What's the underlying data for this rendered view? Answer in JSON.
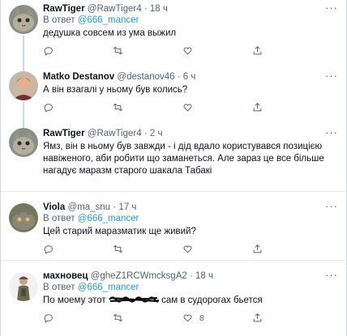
{
  "tweets": [
    {
      "name": "RawTiger",
      "handle": "@RawTiger4",
      "time": "18 ч",
      "reply_prefix": "В ответ",
      "reply_to": "@666_mancer",
      "text": "дедушка совсем из ума выжил",
      "likes": ""
    },
    {
      "name": "Matko Destanov",
      "handle": "@destanov46",
      "time": "6 ч",
      "text": "А він взагалі у ньому був колись?",
      "likes": ""
    },
    {
      "name": "RawTiger",
      "handle": "@RawTiger4",
      "time": "2 ч",
      "text": "Ямз, він в ньому був завжди - і дід вдало користувався позицією навіженого, аби робити що заманеться. Але зараз це все більше нагадує маразм старого шакала Табакі",
      "likes": ""
    },
    {
      "name": "Viola",
      "handle": "@ma_snu",
      "time": "17 ч",
      "reply_prefix": "В ответ",
      "reply_to": "@666_mancer",
      "text": "Цей старий маразматик ще живий?",
      "likes": ""
    },
    {
      "name": "махновец",
      "handle": "@gheZ1RCWmcksgA2",
      "time": "18 ч",
      "reply_prefix": "В ответ",
      "reply_to": "@666_mancer",
      "text_before": "По моему этот",
      "text_after": "сам в судорогах бьется",
      "likes": "8"
    }
  ],
  "icons": [
    "more-icon",
    "reply-icon",
    "retweet-icon",
    "like-icon",
    "share-icon"
  ],
  "colors": {
    "accent": "#1d9bf0",
    "secondary_text": "#536471",
    "divider": "#e6ecf0",
    "thread_line": "#cfd9de"
  }
}
